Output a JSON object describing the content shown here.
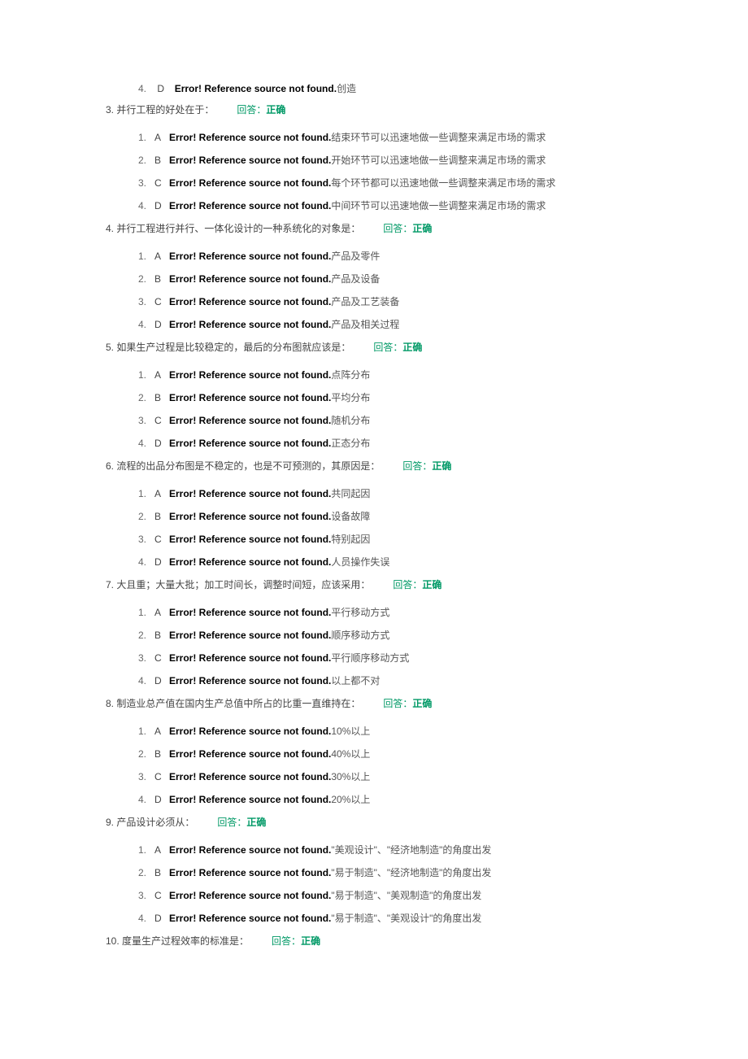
{
  "error_msg": "Error! Reference source not found.",
  "answer_label": "回答：",
  "answer_value": "正确",
  "orphan": {
    "num": "4.",
    "letter": "D",
    "text": "创造"
  },
  "questions": [
    {
      "num": "3.",
      "text": "并行工程的好处在于：",
      "options": [
        {
          "num": "1.",
          "letter": "A",
          "text": "结束环节可以迅速地做一些调整来满足市场的需求"
        },
        {
          "num": "2.",
          "letter": "B",
          "text": "开始环节可以迅速地做一些调整来满足市场的需求"
        },
        {
          "num": "3.",
          "letter": "C",
          "text": "每个环节都可以迅速地做一些调整来满足市场的需求"
        },
        {
          "num": "4.",
          "letter": "D",
          "text": "中间环节可以迅速地做一些调整来满足市场的需求"
        }
      ]
    },
    {
      "num": "4.",
      "text": "并行工程进行并行、一体化设计的一种系统化的对象是：",
      "options": [
        {
          "num": "1.",
          "letter": "A",
          "text": "产品及零件"
        },
        {
          "num": "2.",
          "letter": "B",
          "text": "产品及设备"
        },
        {
          "num": "3.",
          "letter": "C",
          "text": "产品及工艺装备"
        },
        {
          "num": "4.",
          "letter": "D",
          "text": "产品及相关过程"
        }
      ]
    },
    {
      "num": "5.",
      "text": "如果生产过程是比较稳定的，最后的分布图就应该是：",
      "options": [
        {
          "num": "1.",
          "letter": "A",
          "text": "点阵分布"
        },
        {
          "num": "2.",
          "letter": "B",
          "text": "平均分布"
        },
        {
          "num": "3.",
          "letter": "C",
          "text": "随机分布"
        },
        {
          "num": "4.",
          "letter": "D",
          "text": "正态分布"
        }
      ]
    },
    {
      "num": "6.",
      "text": "流程的出品分布图是不稳定的，也是不可预测的，其原因是：",
      "options": [
        {
          "num": "1.",
          "letter": "A",
          "text": "共同起因"
        },
        {
          "num": "2.",
          "letter": "B",
          "text": "设备故障"
        },
        {
          "num": "3.",
          "letter": "C",
          "text": "特别起因"
        },
        {
          "num": "4.",
          "letter": "D",
          "text": "人员操作失误"
        }
      ]
    },
    {
      "num": "7.",
      "text": "大且重；大量大批；加工时间长，调整时间短，应该采用：",
      "options": [
        {
          "num": "1.",
          "letter": "A",
          "text": "平行移动方式"
        },
        {
          "num": "2.",
          "letter": "B",
          "text": "顺序移动方式"
        },
        {
          "num": "3.",
          "letter": "C",
          "text": "平行顺序移动方式"
        },
        {
          "num": "4.",
          "letter": "D",
          "text": "以上都不对"
        }
      ]
    },
    {
      "num": "8.",
      "text": "制造业总产值在国内生产总值中所占的比重一直维持在：",
      "options": [
        {
          "num": "1.",
          "letter": "A",
          "text": "10%以上"
        },
        {
          "num": "2.",
          "letter": "B",
          "text": "40%以上"
        },
        {
          "num": "3.",
          "letter": "C",
          "text": "30%以上"
        },
        {
          "num": "4.",
          "letter": "D",
          "text": "20%以上"
        }
      ]
    },
    {
      "num": "9.",
      "text": "产品设计必须从：",
      "options": [
        {
          "num": "1.",
          "letter": "A",
          "text": "\"美观设计\"、\"经济地制造\"的角度出发"
        },
        {
          "num": "2.",
          "letter": "B",
          "text": "\"易于制造\"、\"经济地制造\"的角度出发"
        },
        {
          "num": "3.",
          "letter": "C",
          "text": "\"易于制造\"、\"美观制造\"的角度出发"
        },
        {
          "num": "4.",
          "letter": "D",
          "text": "\"易于制造\"、\"美观设计\"的角度出发"
        }
      ]
    },
    {
      "num": "10.",
      "text": "度量生产过程效率的标准是：",
      "options": []
    }
  ]
}
